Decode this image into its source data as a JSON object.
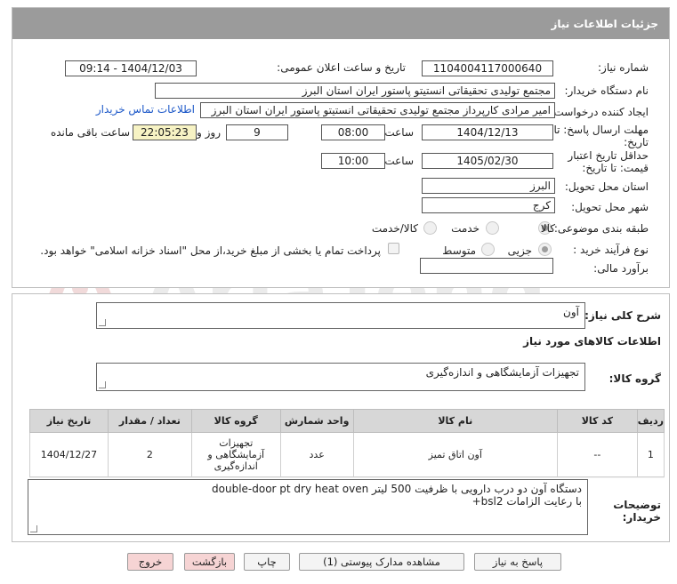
{
  "header": {
    "title": "جزئیات اطلاعات نیاز"
  },
  "fields": {
    "need_number_label": "شماره نیاز:",
    "need_number": "1104004117000640",
    "announce_label": "تاریخ و ساعت اعلان عمومی:",
    "announce_value": "1404/12/03 - 09:14",
    "buyer_label": "نام دستگاه خریدار:",
    "buyer_value": "مجتمع تولیدی تحقیقاتی انستیتو پاستور ایران استان البرز",
    "creator_label": "ایجاد کننده درخواست:",
    "creator_value": "امیر مرادی کارپرداز مجتمع تولیدی تحقیقاتی انستیتو پاستور ایران استان البرز",
    "contact_link": "اطلاعات تماس خریدار",
    "deadline_label_1": "مهلت ارسال پاسخ: تا",
    "deadline_label_2": "تاریخ:",
    "deadline_date": "1404/12/13",
    "time_label": "ساعت",
    "deadline_time": "08:00",
    "days_value": "9",
    "days_label": "روز و",
    "remaining_value": "22:05:23",
    "remaining_label": "ساعت باقی مانده",
    "validity_label_1": "حداقل تاریخ اعتبار",
    "validity_label_2": "قیمت: تا تاریخ:",
    "validity_date": "1405/02/30",
    "validity_time": "10:00",
    "province_label": "استان محل تحویل:",
    "province_value": "البرز",
    "city_label": "شهر محل تحویل:",
    "city_value": "کرج",
    "category_label": "طبقه بندی موضوعی:",
    "category_options": [
      "کالا",
      "خدمت",
      "کالا/خدمت"
    ],
    "process_label": "نوع فرآیند خرید :",
    "process_options": [
      "جزیی",
      "متوسط"
    ],
    "payment_note": "پرداخت تمام یا بخشی از مبلغ خرید،از محل \"اسناد خزانه اسلامی\" خواهد بود.",
    "estimate_label": "برآورد مالی:",
    "estimate_value": ""
  },
  "description": {
    "label": "شرح کلی نیاز:",
    "value": "آون"
  },
  "goods": {
    "section_title": "اطلاعات کالاهای مورد نیاز",
    "group_label": "گروه کالا:",
    "group_value": "تجهیزات آزمایشگاهی و اندازه‌گیری"
  },
  "table": {
    "headers": [
      "ردیف",
      "کد کالا",
      "نام کالا",
      "واحد شمارش",
      "گروه کالا",
      "تعداد / مقدار",
      "تاریخ نیاز"
    ],
    "rows": [
      [
        "1",
        "--",
        "آون اتاق تمیز",
        "عدد",
        "تجهیزات آزمایشگاهی و اندازه‌گیری",
        "2",
        "1404/12/27"
      ]
    ]
  },
  "buyer_notes": {
    "label_1": "توضیحات",
    "label_2": "خریدار:",
    "line_1": "دستگاه آون دو درب دارویی با ظرفیت 500 لیتر double-door pt dry heat oven",
    "line_2": "با رعایت الزامات bsl2+"
  },
  "buttons": {
    "reply": "پاسخ به نیاز",
    "attachments": "مشاهده مدارک پیوستی (1)",
    "print": "چاپ",
    "back": "بازگشت",
    "exit": "خروج"
  },
  "colors": {
    "header_bg": "#9b9b9b",
    "remaining_bg": "#f7f3c4",
    "link": "#1b57c8",
    "pink_button": "#f6d4d4"
  }
}
